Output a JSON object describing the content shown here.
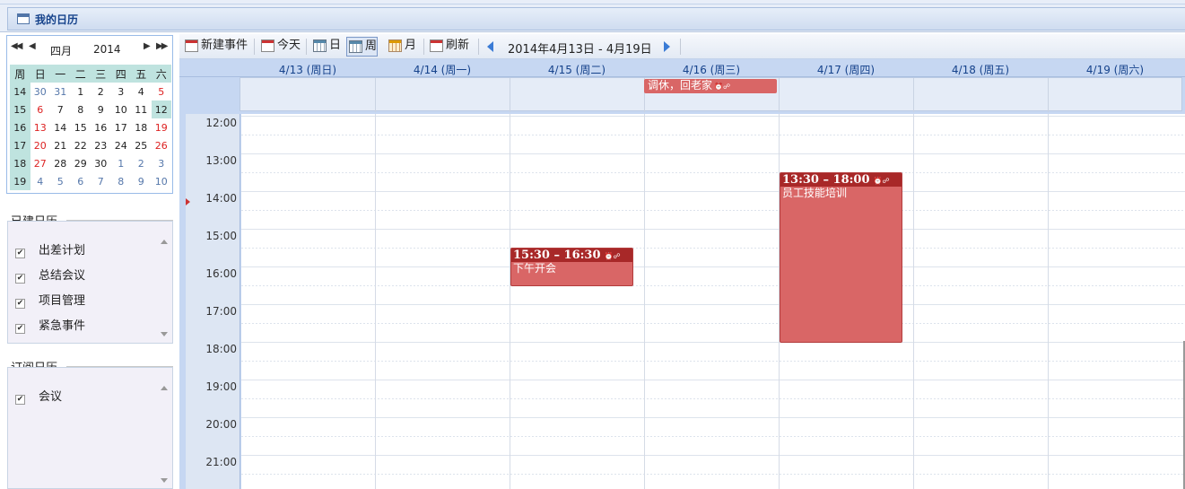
{
  "window": {
    "title": "我的日历",
    "title_icon": "calendar-icon"
  },
  "mini_calendar": {
    "nav_prev_year": "◀◀",
    "nav_prev_month": "◀",
    "nav_next_month": "▶",
    "nav_next_year": "▶▶",
    "month": "四月",
    "year": "2014",
    "weekday_headers": [
      "周",
      "日",
      "一",
      "二",
      "三",
      "四",
      "五",
      "六"
    ],
    "weeks": [
      {
        "week": "14",
        "days": [
          "30",
          "31",
          "1",
          "2",
          "3",
          "4",
          "5"
        ]
      },
      {
        "week": "15",
        "days": [
          "6",
          "7",
          "8",
          "9",
          "10",
          "11",
          "12"
        ]
      },
      {
        "week": "16",
        "days": [
          "13",
          "14",
          "15",
          "16",
          "17",
          "18",
          "19"
        ]
      },
      {
        "week": "17",
        "days": [
          "20",
          "21",
          "22",
          "23",
          "24",
          "25",
          "26"
        ]
      },
      {
        "week": "18",
        "days": [
          "27",
          "28",
          "29",
          "30",
          "1",
          "2",
          "3"
        ]
      },
      {
        "week": "19",
        "days": [
          "4",
          "5",
          "6",
          "7",
          "8",
          "9",
          "10"
        ]
      }
    ],
    "selected_day": "12"
  },
  "created_calendars": {
    "label": "已建日历",
    "items": [
      {
        "label": "出差计划",
        "checked": true
      },
      {
        "label": "总结会议",
        "checked": true
      },
      {
        "label": "项目管理",
        "checked": true
      },
      {
        "label": "紧急事件",
        "checked": true
      }
    ]
  },
  "subscribed_calendars": {
    "label": "订阅日历",
    "items": [
      {
        "label": "会议",
        "checked": true
      }
    ]
  },
  "toolbar": {
    "new_event": "新建事件",
    "today": "今天",
    "day": "日",
    "week": "周",
    "month": "月",
    "refresh": "刷新",
    "active_view": "周",
    "date_range": "2014年4月13日 - 4月19日"
  },
  "week_view": {
    "days": [
      "4/13 (周日)",
      "4/14 (周一)",
      "4/15 (周二)",
      "4/16 (周三)",
      "4/17 (周四)",
      "4/18 (周五)",
      "4/19 (周六)"
    ],
    "hours": [
      "12:00",
      "13:00",
      "14:00",
      "15:00",
      "16:00",
      "17:00",
      "18:00",
      "19:00",
      "20:00",
      "21:00"
    ],
    "all_day_events": [
      {
        "title": "调休，回老家",
        "day": "4/16 (周三)"
      }
    ],
    "events": [
      {
        "time": "15:30 – 16:30",
        "title": "下午开会",
        "day": "4/15 (周二)",
        "start": 15.5,
        "end": 16.5
      },
      {
        "time": "13:30 – 18:00",
        "title": "员工技能培训",
        "day": "4/17 (周四)",
        "start": 13.5,
        "end": 18.0
      }
    ]
  },
  "colors": {
    "event": "#d96666",
    "event_header": "#a82828",
    "header_bg": "#c6d7f2",
    "accent": "#15428b"
  }
}
